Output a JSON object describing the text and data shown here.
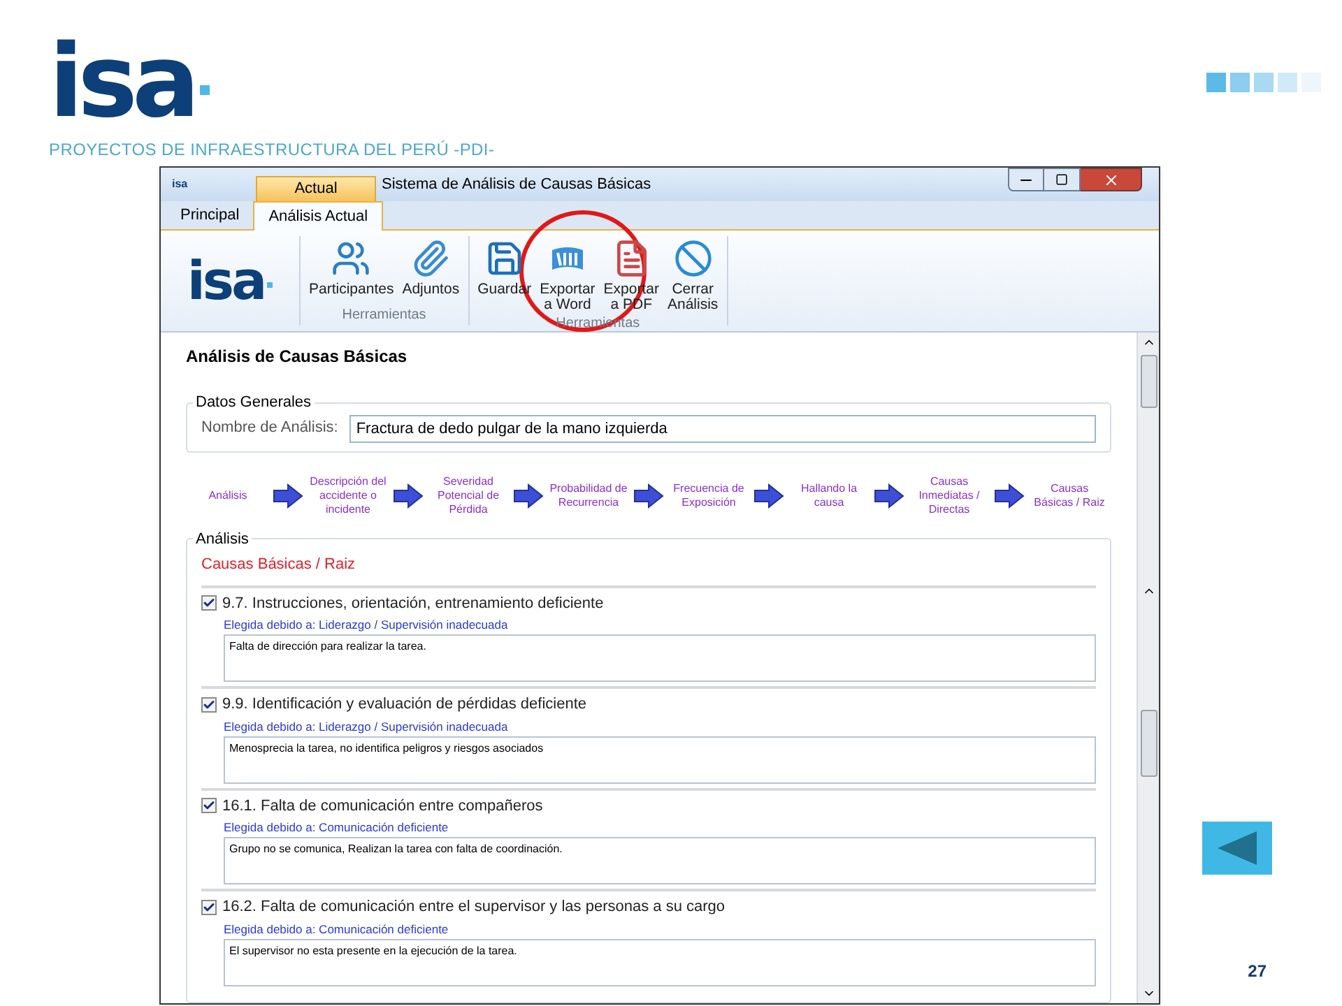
{
  "slide": {
    "logo_text": "isa",
    "tagline": "PROYECTOS DE INFRAESTRUCTURA DEL PERÚ -PDI-",
    "page_number": "27"
  },
  "window": {
    "app_icon_text": "isa",
    "contextual_tab": "Actual",
    "title": "Sistema de Análisis de Causas Básicas"
  },
  "tabs": [
    {
      "label": "Principal",
      "selected": false
    },
    {
      "label": "Análisis Actual",
      "selected": true
    }
  ],
  "ribbon": {
    "logo_text": "isa",
    "groups": [
      {
        "label": "Herramientas",
        "buttons": [
          {
            "kind": "users",
            "label": "Participantes"
          },
          {
            "kind": "clip",
            "label": "Adjuntos"
          }
        ]
      },
      {
        "label": "Herramientas",
        "buttons": [
          {
            "kind": "save",
            "label": "Guardar"
          },
          {
            "kind": "word",
            "label": "Exportar\na Word"
          },
          {
            "kind": "pdf",
            "label": "Exportar\na PDF"
          },
          {
            "kind": "cancel",
            "label": "Cerrar\nAnálisis"
          }
        ]
      }
    ]
  },
  "content": {
    "heading": "Análisis de Causas Básicas",
    "general": {
      "legend": "Datos Generales",
      "field_label": "Nombre de Análisis:",
      "field_value": "Fractura de dedo pulgar de la mano izquierda"
    },
    "steps": [
      "Análisis",
      "Descripción del accidente o incidente",
      "Severidad Potencial de Pérdida",
      "Probabilidad de Recurrencia",
      "Frecuencia de Exposición",
      "Hallando la causa",
      "Causas Inmediatas / Directas",
      "Causas Básicas / Raiz"
    ],
    "analysis": {
      "legend": "Análisis",
      "section_title": "Causas Básicas / Raiz",
      "items": [
        {
          "checked": true,
          "title": "9.7. Instrucciones, orientación, entrenamiento deficiente",
          "reason": "Elegida debido a: Liderazgo / Supervisión inadecuada",
          "comment": "Falta de dirección para realizar la tarea."
        },
        {
          "checked": true,
          "title": "9.9. Identificación y evaluación de pérdidas deficiente",
          "reason": "Elegida debido a: Liderazgo / Supervisión inadecuada",
          "comment": "Menosprecia la tarea, no identifica peligros y riesgos asociados"
        },
        {
          "checked": true,
          "title": "16.1. Falta de comunicación entre compañeros",
          "reason": "Elegida debido a: Comunicación deficiente",
          "comment": "Grupo no se comunica, Realizan la tarea con falta de coordinación."
        },
        {
          "checked": true,
          "title": "16.2. Falta de comunicación entre el supervisor y las personas a su cargo",
          "reason": "Elegida debido a: Comunicación deficiente",
          "comment": "El supervisor no esta presente en la ejecución de la tarea."
        }
      ]
    }
  }
}
